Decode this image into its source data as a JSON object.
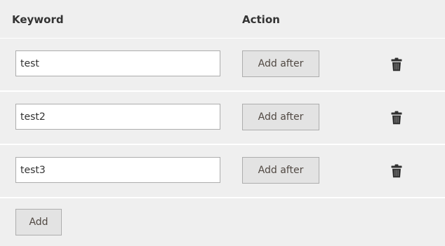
{
  "table": {
    "headers": {
      "keyword": "Keyword",
      "action": "Action"
    },
    "rows": [
      {
        "keyword": "test",
        "action_label": "Add after",
        "delete_icon": "trash-icon"
      },
      {
        "keyword": "test2",
        "action_label": "Add after",
        "delete_icon": "trash-icon"
      },
      {
        "keyword": "test3",
        "action_label": "Add after",
        "delete_icon": "trash-icon"
      }
    ],
    "add_label": "Add"
  },
  "colors": {
    "row_background": "#efefef",
    "button_background": "#e3e3e3",
    "border": "#adadad",
    "icon": "#303030"
  }
}
